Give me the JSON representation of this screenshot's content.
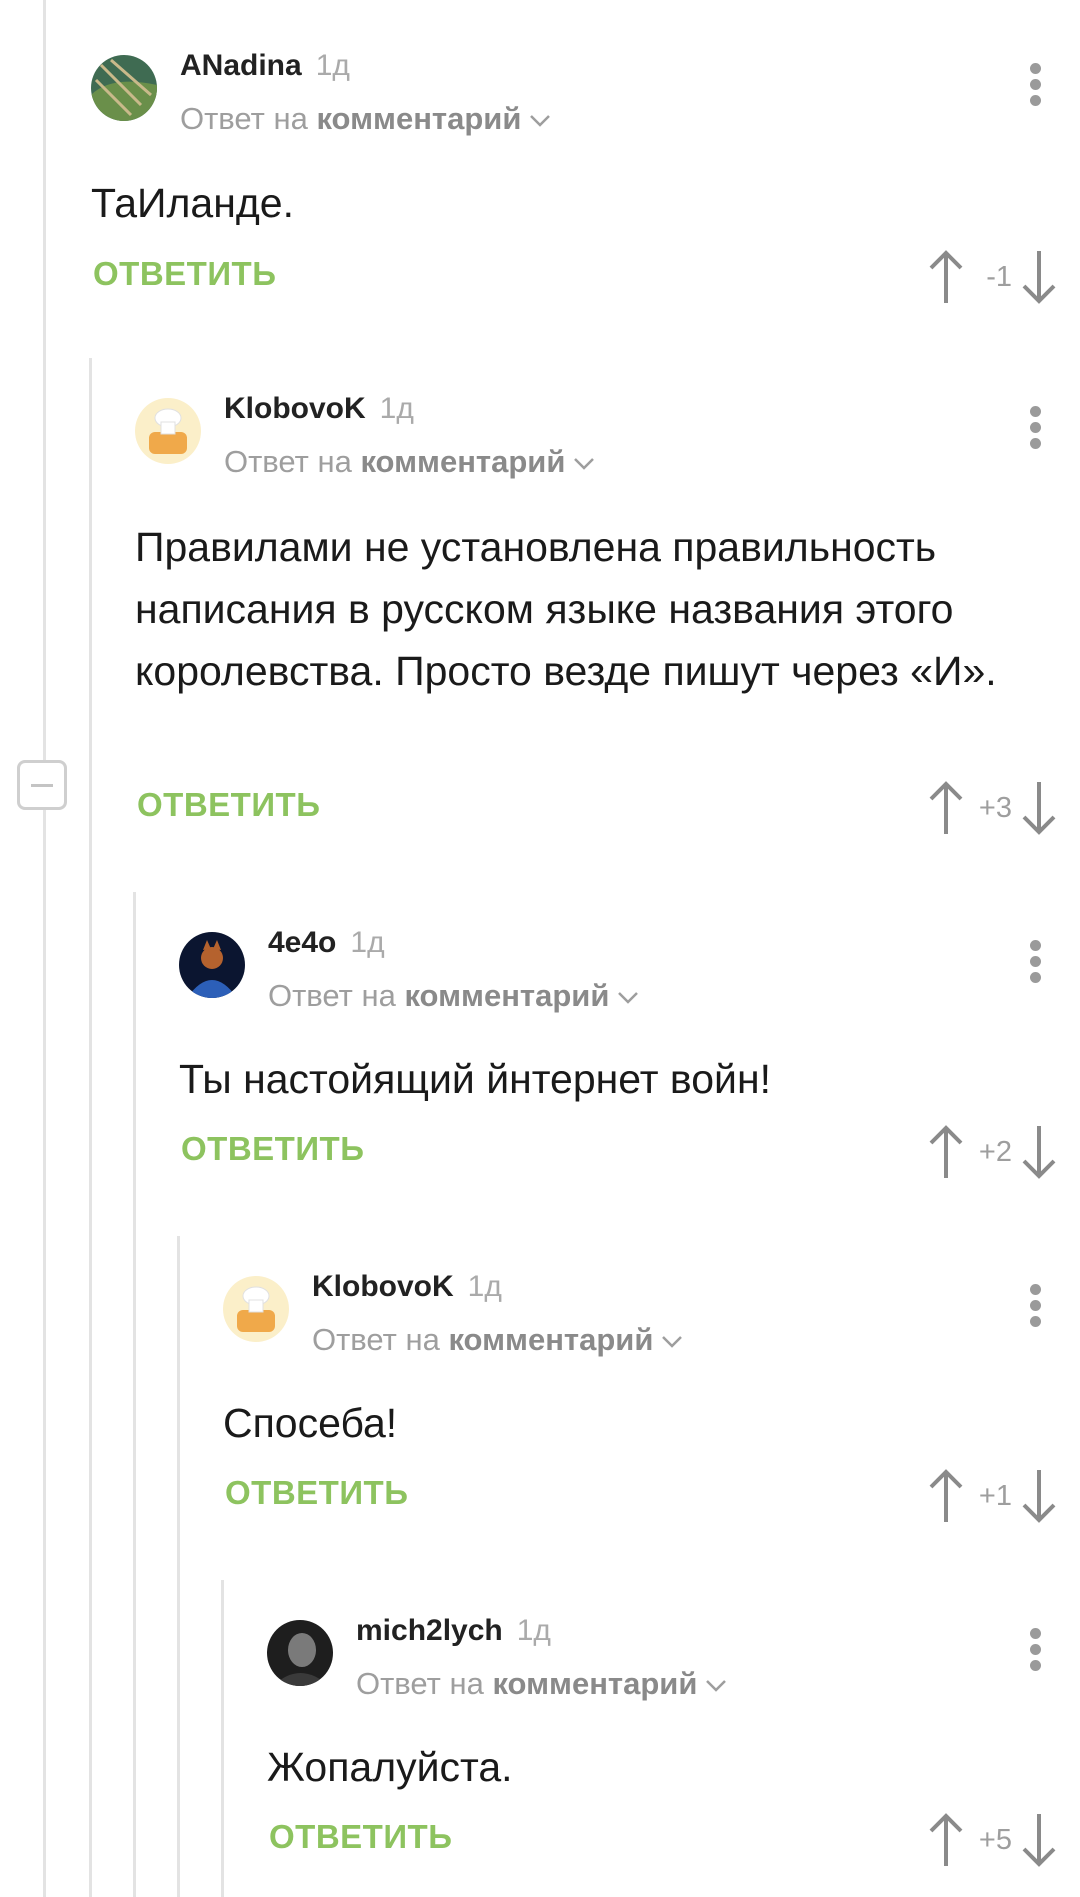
{
  "labels": {
    "reply_to_prefix": "Ответ на",
    "reply_to_target": "комментарий",
    "reply_button": "ОТВЕТИТЬ"
  },
  "colors": {
    "accent_green": "#8dc35f",
    "muted_gray": "#9e9e9e",
    "thread_line": "#e3e3e3"
  },
  "comments": [
    {
      "author": "ANadina",
      "time": "1д",
      "text": "ТаИланде.",
      "score": "-1",
      "avatar_icon": "avatar-anadina"
    },
    {
      "author": "KlobovoK",
      "time": "1д",
      "text": "Правилами не установлена правильность написания в русском языке названия этого королевства. Просто везде пишут через «И».",
      "score": "+3",
      "avatar_icon": "avatar-klobovok"
    },
    {
      "author": "4e4o",
      "time": "1д",
      "text": "Ты настойящий йнтернет войн!",
      "score": "+2",
      "avatar_icon": "avatar-4e4o"
    },
    {
      "author": "KlobovoK",
      "time": "1д",
      "text": "Спосеба!",
      "score": "+1",
      "avatar_icon": "avatar-klobovok"
    },
    {
      "author": "mich2lych",
      "time": "1д",
      "text": "Жопалуйста.",
      "score": "+5",
      "avatar_icon": "avatar-mich2lych"
    }
  ]
}
